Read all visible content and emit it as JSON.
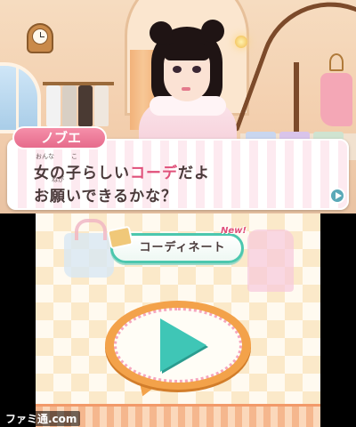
{
  "dialogue": {
    "speaker": "ノブエ",
    "ruby_onna": "おんな",
    "ruby_ko": "こ",
    "ruby_negai": "ねが",
    "line1_prefix": "女の子らしい",
    "line1_accent": "コーデ",
    "line1_suffix": "だよ",
    "line2": "お願いできるかな？"
  },
  "menu": {
    "coordinate_label": "コーディネート",
    "new_badge": "New!"
  },
  "watermark": "ファミ通.com",
  "colors": {
    "accent_pink": "#e0507a",
    "teal": "#3fc6b6",
    "orange": "#f3a24a"
  },
  "icons": {
    "next": "triangle-right-icon",
    "play": "play-icon"
  }
}
